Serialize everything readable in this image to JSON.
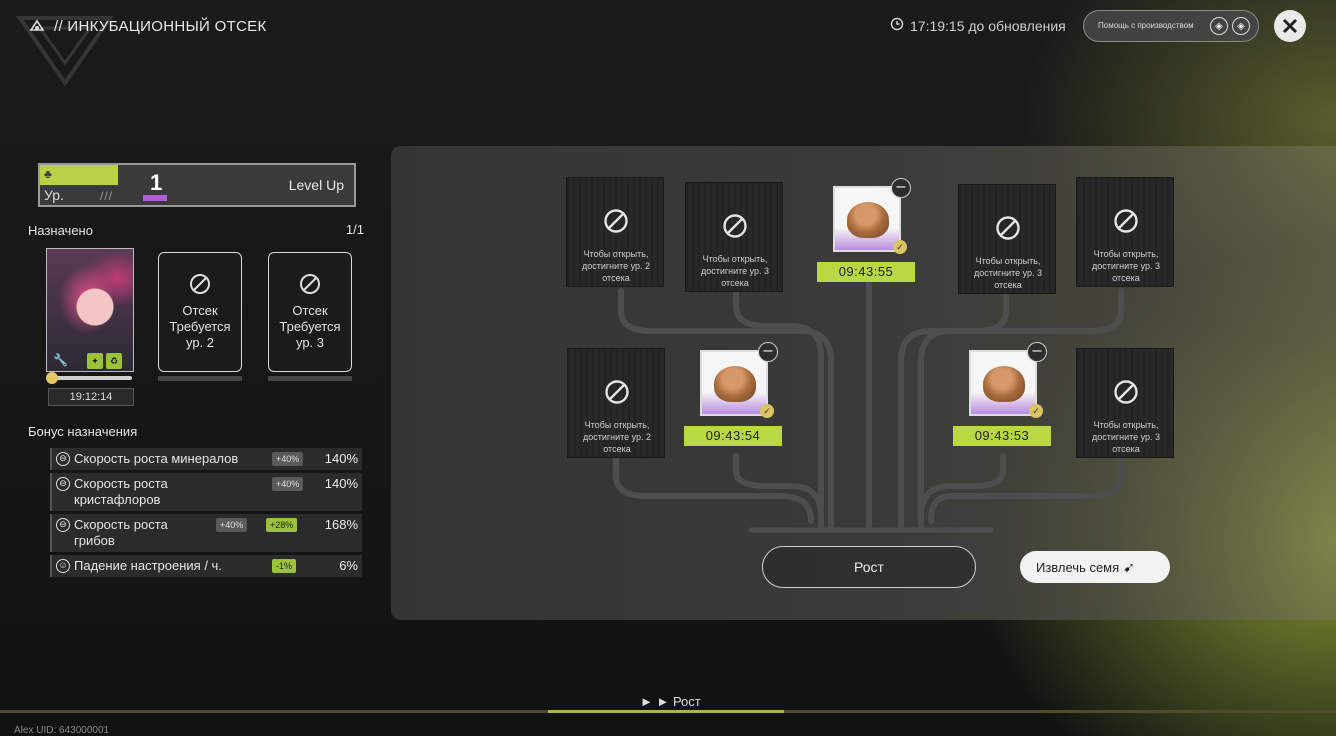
{
  "header": {
    "title": "// ИНКУБАЦИОННЫЙ ОТСЕК",
    "title_icon": "incubator-icon",
    "timer_text": "17:19:15 до обновления",
    "help_text": "Помощь с производством",
    "close_icon": "close-icon"
  },
  "level_panel": {
    "caption": "",
    "level_prefix": "Ур.",
    "slashes": "///",
    "level_value": "1",
    "level_up_label": "Level Up"
  },
  "assigned": {
    "label": "Назначено",
    "count": "1/1",
    "character_time": "19:12:14",
    "slots": [
      {
        "text": "Отсек\nТребуется\nур. 2"
      },
      {
        "text": "Отсек\nТребуется\nур. 3"
      }
    ]
  },
  "bonus": {
    "title": "Бонус назначения",
    "rows": [
      {
        "name": "Скорость роста минералов",
        "chips": [
          {
            "text": "+40%",
            "style": "grey"
          }
        ],
        "pct": "140%"
      },
      {
        "name": "Скорость роста кристафлоров",
        "chips": [
          {
            "text": "+40%",
            "style": "grey"
          }
        ],
        "pct": "140%"
      },
      {
        "name": "Скорость роста грибов",
        "chips": [
          {
            "text": "+40%",
            "style": "grey"
          },
          {
            "text": "+28%",
            "style": "green"
          }
        ],
        "pct": "168%"
      },
      {
        "name": "Падение настроения / ч.",
        "chips": [
          {
            "text": "-1%",
            "style": "green"
          }
        ],
        "pct": "6%"
      }
    ]
  },
  "tree": {
    "locked_text_lvl2": "Чтобы открыть, достигните ур. 2 отсека",
    "locked_text_lvl3": "Чтобы открыть, достигните ур. 3 отсека",
    "pod_times": [
      "09:43:55",
      "09:43:54",
      "09:43:53"
    ],
    "grow_button": "Рост",
    "extract_button": "Извлечь семя"
  },
  "footer": {
    "nav_label": "► ► Рост",
    "uid": "Alex   UID: 643000001"
  },
  "colors": {
    "accent_green": "#b9d844",
    "level_purple": "#b15fd6"
  }
}
